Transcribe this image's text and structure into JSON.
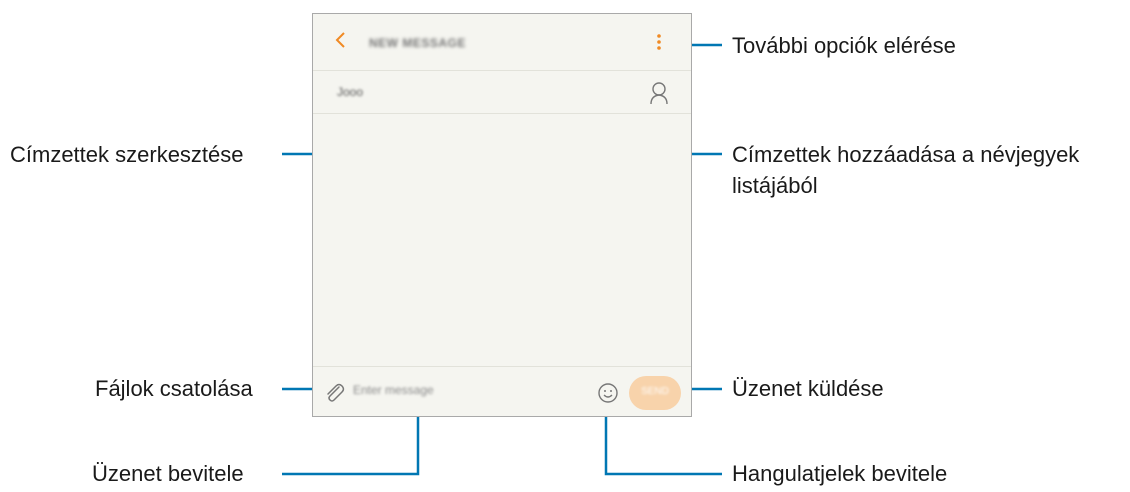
{
  "screen": {
    "title": "NEW MESSAGE",
    "recipient": "Jooo",
    "message_placeholder": "Enter message",
    "send_label": "SEND"
  },
  "icons": {
    "back": "chevron-left-icon",
    "more": "more-vertical-icon",
    "contacts": "person-icon",
    "attach": "paperclip-icon",
    "emoji": "smiley-icon"
  },
  "colors": {
    "accent": "#f08a24",
    "send_button": "#f8d3ab",
    "callout_line": "#0077b3"
  },
  "callouts": {
    "more_options": "További opciók elérése",
    "edit_recipients": "Címzettek szerkesztése",
    "add_from_contacts_1": "Címzettek hozzáadása a névjegyek",
    "add_from_contacts_2": "listájából",
    "attach_files": "Fájlok csatolása",
    "send_message": "Üzenet küldése",
    "enter_message": "Üzenet bevitele",
    "enter_emoticons": "Hangulatjelek bevitele"
  }
}
